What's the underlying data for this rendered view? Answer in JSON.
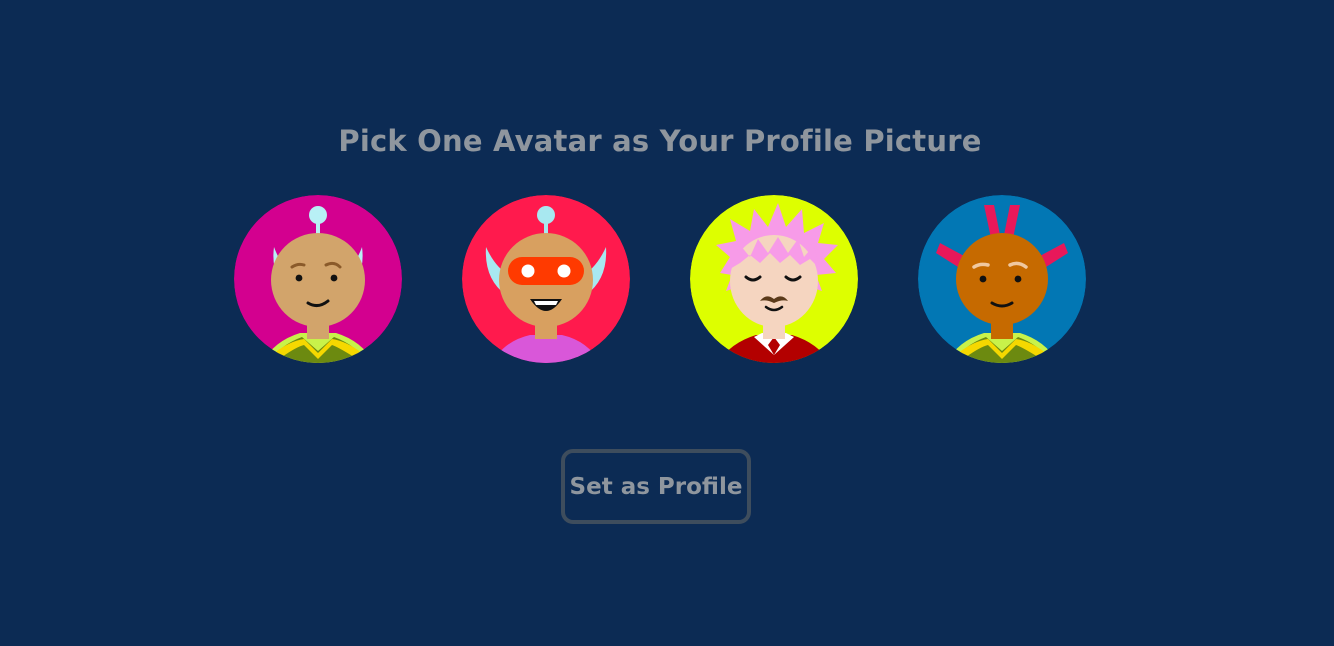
{
  "heading": "Pick One Avatar as Your Profile Picture",
  "avatars": [
    {
      "icon": "alien-avatar-icon",
      "background": "#d3008f"
    },
    {
      "icon": "masked-alien-avatar-icon",
      "background": "#ff1a4d"
    },
    {
      "icon": "pink-hair-man-avatar-icon",
      "background": "#ddff00"
    },
    {
      "icon": "mohawk-avatar-icon",
      "background": "#0277b4"
    }
  ],
  "button": {
    "label": "Set as Profile"
  },
  "colors": {
    "page_background": "#0c2b54",
    "text": "#8f969e",
    "button_border": "#3e4d5d"
  }
}
